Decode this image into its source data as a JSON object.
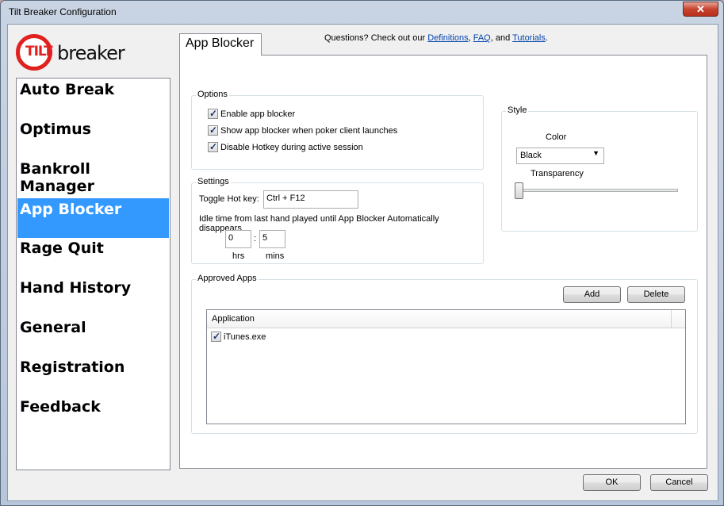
{
  "window": {
    "title": "Tilt Breaker Configuration",
    "close_glyph": "✕"
  },
  "logo": {
    "tilt_text": "TILT",
    "breaker_text": "breaker"
  },
  "sidebar": {
    "items": [
      {
        "label": "Auto Break",
        "active": false
      },
      {
        "label": "Optimus",
        "active": false
      },
      {
        "label": "Bankroll Manager",
        "active": false
      },
      {
        "label": "App Blocker",
        "active": true
      },
      {
        "label": "Rage Quit",
        "active": false
      },
      {
        "label": "Hand History",
        "active": false
      },
      {
        "label": "General",
        "active": false
      },
      {
        "label": "Registration",
        "active": false
      },
      {
        "label": "Feedback",
        "active": false
      }
    ]
  },
  "tab": {
    "label": "App Blocker"
  },
  "help": {
    "prefix": "Questions? Check out our ",
    "definitions": "Definitions",
    "sep1": ",",
    "faq": "FAQ",
    "sep2": ", and",
    "tutorials": "Tutorials",
    "suffix": "."
  },
  "options": {
    "title": "Options",
    "enable_app_blocker": {
      "label": "Enable app blocker",
      "checked": true
    },
    "show_on_launch": {
      "label": "Show app blocker when poker client launches",
      "checked": true
    },
    "disable_hotkey": {
      "label": "Disable Hotkey during active session",
      "checked": true
    }
  },
  "settings": {
    "title": "Settings",
    "hotkey_label": "Toggle Hot key:",
    "hotkey_value": "Ctrl + F12",
    "idle_label": "Idle time from last hand played until App Blocker Automatically disappears",
    "hours_value": "0",
    "colon": ":",
    "minutes_value": "5",
    "hrs_label": "hrs",
    "mins_label": "mins"
  },
  "style": {
    "title": "Style",
    "color_label": "Color",
    "color_value": "Black",
    "dropdown_glyph": "▼",
    "transparency_label": "Transparency",
    "transparency_level": 0
  },
  "approved_apps": {
    "title": "Approved Apps",
    "add_label": "Add",
    "delete_label": "Delete",
    "column_header": "Application",
    "rows": [
      {
        "name": "iTunes.exe",
        "checked": true
      }
    ]
  },
  "footer": {
    "ok_label": "OK",
    "cancel_label": "Cancel"
  }
}
